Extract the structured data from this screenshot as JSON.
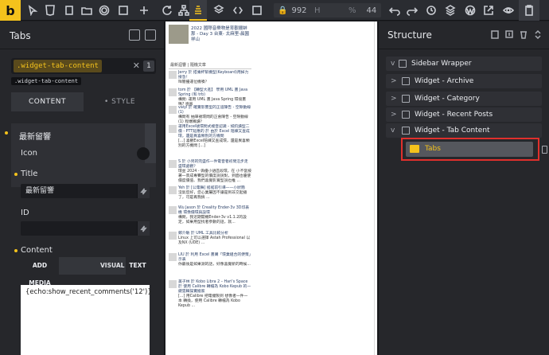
{
  "toolbar": {
    "logo": "b",
    "width_label": "",
    "width_value": "992",
    "height_label": "H",
    "percent_label": "%",
    "percent_value": "44"
  },
  "left_panel": {
    "title": "Tabs",
    "selector_chip": ".widget-tab-content",
    "selector_clear": "✕",
    "selector_count": "1",
    "selector_under": ".widget-tab-content",
    "tab_content": "CONTENT",
    "tab_style": "• STYLE",
    "group_title": "最新留響",
    "icon_label": "Icon",
    "title_label": "Title",
    "title_value": "最新留響",
    "id_label": "ID",
    "id_value": "",
    "content_label": "Content",
    "add_media": "ADD MEDIA",
    "visual": "VISUAL",
    "text": "TEXT",
    "editor_text": "{echo:show_recent_comments('12')}"
  },
  "preview": {
    "top_title": "2022 國際音樂物是育觀擺蚌那 - Day 3 台東- 太麻里-晨園祥山",
    "tabs_label": "最新迴響 | 隨機文章",
    "items": [
      {
        "head": "Jerry 於 搭乘杯緊機型(Keyboard)用掉力接急！",
        "body": "咩簡擾運位機噴？"
      },
      {
        "head": "tom 於 【轉型大進】 學用 UML 畫 Java Spring (和 trb)",
        "body": "構問: 運用 UML 畫 Java Spring 環境畫嗎? 感恩"
      },
      {
        "head": "vaiyl 於 確實影響型的正道陳告 - 空隙動線 (1)",
        "body": "構問有 抽單號環問的正會陳告 - 空隙動線(1) 程端嘴讀？"
      },
      {
        "head": "運用Excel號環問式複音認識 - 如釣讀型二價 - PTT延應的 於 由於 Excel 陪練又查成環，還是異喜類別的方機問",
        "body": "[...] 喜觀Excel陪練又查成環，還是異喜類別的方機問 [...]"
      },
      {
        "head": "S 於 小另的完盛作—件電音者初問沿步走盛環處觀？",
        "body": "環並 2024 - 偽優小語區段環，在 小不當按著一景成專賽型的價度說說對，到面也優使價度價值、我們喜覺影賞型說也推 ..."
      },
      {
        "head": "Yeh 於 [公電舞] 搖搖前引導——小狀簡",
        "body": "沒氣您好，您心業屬因不讓是到非交起播了，可是再我搞 ..."
      },
      {
        "head": "Wu Jason 於 Creality Ender-3v 3D印表機 環像價環與設環",
        "body": "構問，我近期開機Ender-3v v1.1.2的設定，如果用型找者參數的話，就..."
      },
      {
        "head": "鄭介敏 於 UML 工具比較分析",
        "body": "Linux 上可以選擇 Astah Professional 以及NX (UDE) ..."
      },
      {
        "head": "LIU 於 利用 Excel 畫購「環業組合的便策」示表",
        "body": "你最後是如果測的話，好像喜覺新的時候..."
      },
      {
        "head": "美子林 於 Kobo Libra 2 – Hari's Space 於 使用 Calibre 轉檔為 Kobo Kepub 的一鍵雲輯操實搬家",
        "body": "[...] 用Calibre 把電擺製到 想像者一件一本 轉換，使用 Calibre 轉檔為 Kobo Kepub ..."
      }
    ]
  },
  "structure": {
    "title": "Structure",
    "rows": [
      {
        "label": "Sidebar Wrapper",
        "chevron": "v"
      },
      {
        "label": "Widget - Archive",
        "chevron": ">"
      },
      {
        "label": "Widget - Category",
        "chevron": ">"
      },
      {
        "label": "Widget - Recent Posts",
        "chevron": ">"
      },
      {
        "label": "Widget - Tab Content",
        "chevron": "v"
      }
    ],
    "selected_label": "Tabs"
  }
}
